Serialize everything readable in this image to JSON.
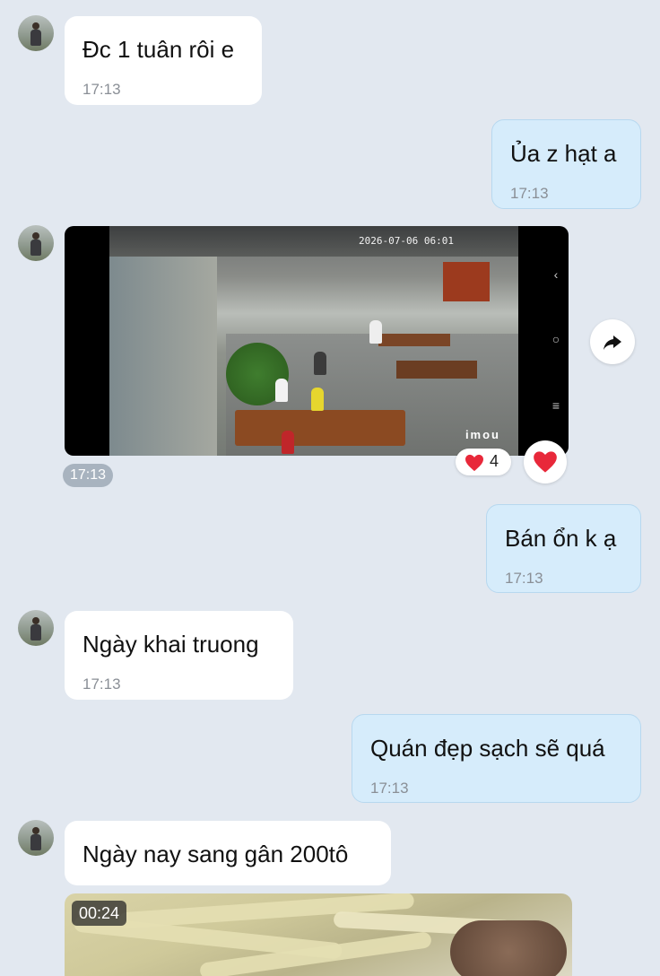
{
  "messages": [
    {
      "text": "Đc 1 tuân rôi e",
      "time": "17:13"
    },
    {
      "text": "Ủa z hạt a",
      "time": "17:13"
    },
    {
      "text": "Bán ổn k ạ",
      "time": "17:13"
    },
    {
      "text": "Ngày khai truong",
      "time": "17:13"
    },
    {
      "text": "Quán đẹp sạch sẽ quá",
      "time": "17:13"
    },
    {
      "text": "Ngày nay sang gân 200tô",
      "time": ""
    }
  ],
  "video_message": {
    "timestamp_overlay": "2026-07-06 06:01",
    "brand_overlay": "imou",
    "time": "17:13",
    "reaction_icon": "heart-icon",
    "reaction_count": "4",
    "forward_icon": "forward-arrow-icon"
  },
  "video_thumbnail": {
    "duration": "00:24"
  },
  "colors": {
    "background": "#e2e8f0",
    "incoming_bubble": "#ffffff",
    "outgoing_bubble": "#d6ecfb",
    "heart": "#e8283a"
  }
}
